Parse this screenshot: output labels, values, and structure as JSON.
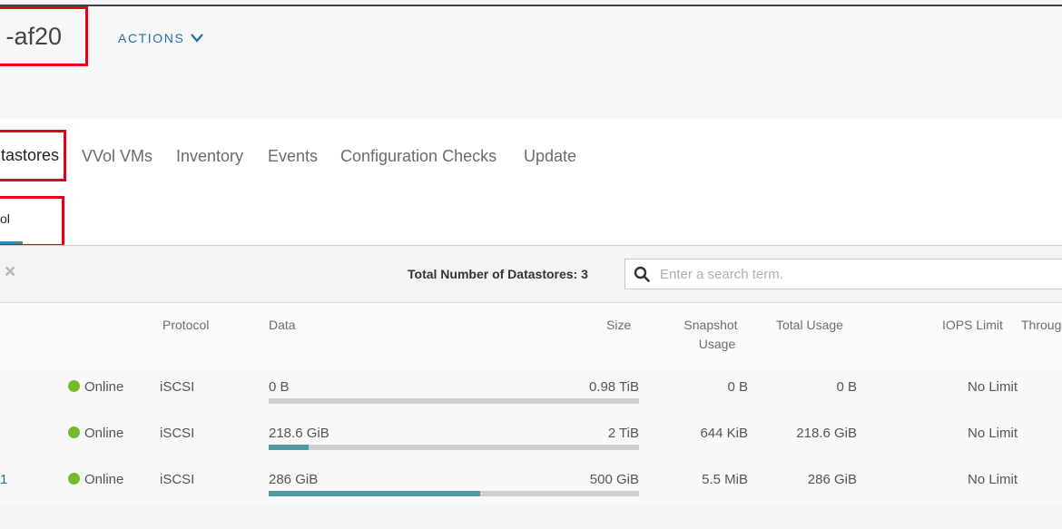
{
  "header": {
    "title": "-af20",
    "actions_label": "ACTIONS"
  },
  "tabs": {
    "active": "tastores",
    "items": [
      "VVol VMs",
      "Inventory",
      "Events",
      "Configuration Checks",
      "Update"
    ]
  },
  "subtab": {
    "label": "ol"
  },
  "toolbar": {
    "close_icon": "×",
    "total_label": "Total Number of Datastores: 3",
    "search_placeholder": "Enter a search term."
  },
  "table": {
    "headers": {
      "protocol": "Protocol",
      "data": "Data",
      "size": "Size",
      "snapshot_line1": "Snapshot",
      "snapshot_line2": "Usage",
      "total_usage": "Total Usage",
      "iops_limit": "IOPS Limit",
      "throughput": "Throug"
    },
    "rows": [
      {
        "name": "",
        "status": "Online",
        "protocol": "iSCSI",
        "data": "0 B",
        "size": "0.98 TiB",
        "snapshot": "0 B",
        "total": "0 B",
        "iops": "No Limit",
        "used_fraction": 0.0
      },
      {
        "name": "",
        "status": "Online",
        "protocol": "iSCSI",
        "data": "218.6 GiB",
        "size": "2 TiB",
        "snapshot": "644 KiB",
        "total": "218.6 GiB",
        "iops": "No Limit",
        "used_fraction": 0.107
      },
      {
        "name": "1",
        "status": "Online",
        "protocol": "iSCSI",
        "data": "286 GiB",
        "size": "500 GiB",
        "snapshot": "5.5 MiB",
        "total": "286 GiB",
        "iops": "No Limit",
        "used_fraction": 0.572
      }
    ]
  },
  "colors": {
    "accent": "#1f6fa8",
    "status_online": "#74bb2c",
    "bar_fill": "#4f9aa3",
    "highlight_box": "#e0001b"
  }
}
